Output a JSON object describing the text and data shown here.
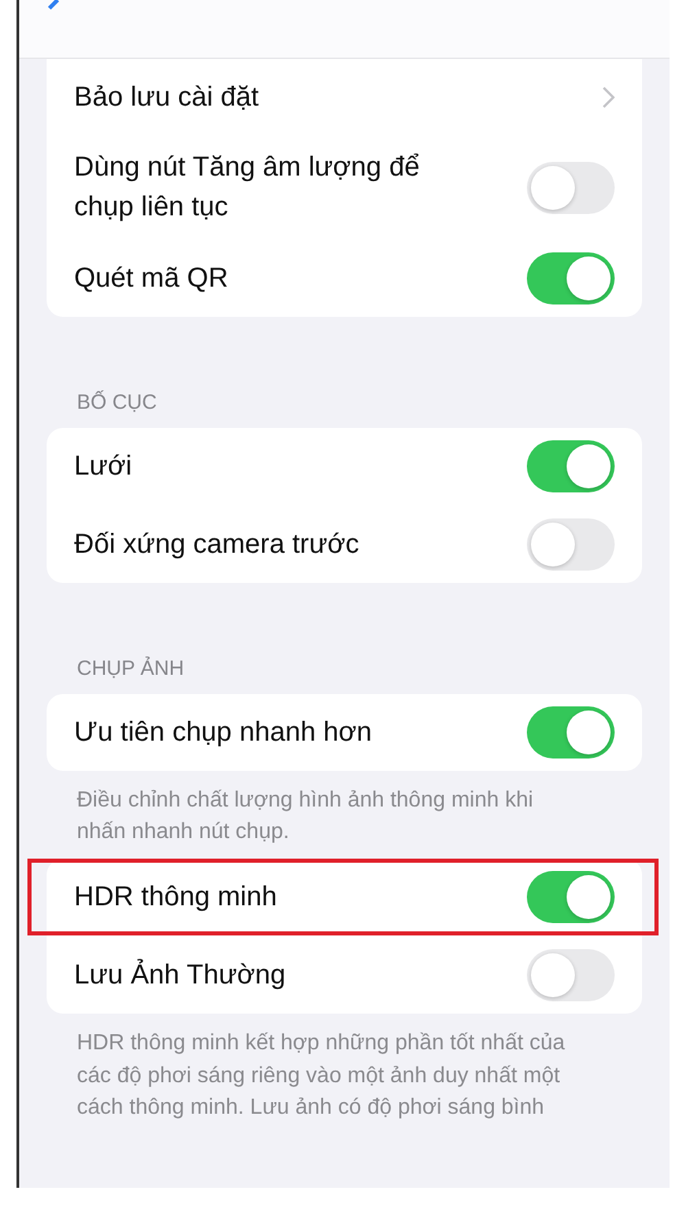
{
  "sections": [
    {
      "rows": [
        {
          "kind": "chevron",
          "label": "Bảo lưu cài đặt",
          "highlighted": false
        },
        {
          "kind": "toggle",
          "label": "Dùng nút Tăng âm lượng để chụp liên tục",
          "on": false,
          "highlighted": false
        },
        {
          "kind": "toggle",
          "label": "Quét mã QR",
          "on": true,
          "highlighted": false
        }
      ]
    },
    {
      "header": "BỐ CỤC",
      "rows": [
        {
          "kind": "toggle",
          "label": "Lưới",
          "on": true,
          "highlighted": false
        },
        {
          "kind": "toggle",
          "label": "Đối xứng camera trước",
          "on": false,
          "highlighted": false
        }
      ]
    },
    {
      "header": "CHỤP ẢNH",
      "footer": "Điều chỉnh chất lượng hình ảnh thông minh khi nhấn nhanh nút chụp.",
      "rows": [
        {
          "kind": "toggle",
          "label": "Ưu tiên chụp nhanh hơn",
          "on": true,
          "highlighted": false
        }
      ]
    },
    {
      "footer": "HDR thông minh kết hợp những phần tốt nhất của các độ phơi sáng riêng vào một ảnh duy nhất một cách thông minh. Lưu ảnh có độ phơi sáng bình",
      "rows": [
        {
          "kind": "toggle",
          "label": "HDR thông minh",
          "on": true,
          "highlighted": true
        },
        {
          "kind": "toggle",
          "label": "Lưu Ảnh Thường",
          "on": false,
          "highlighted": false
        }
      ]
    }
  ]
}
